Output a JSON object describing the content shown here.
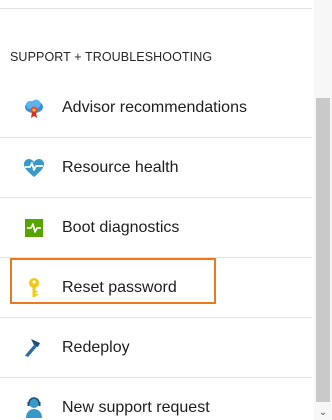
{
  "section": {
    "title": "SUPPORT + TROUBLESHOOTING"
  },
  "items": [
    {
      "label": "Advisor recommendations",
      "icon": "advisor-icon"
    },
    {
      "label": "Resource health",
      "icon": "heart-icon"
    },
    {
      "label": "Boot diagnostics",
      "icon": "diagnostics-icon"
    },
    {
      "label": "Reset password",
      "icon": "key-icon",
      "highlighted": true
    },
    {
      "label": "Redeploy",
      "icon": "hammer-icon"
    },
    {
      "label": "New support request",
      "icon": "support-person-icon"
    }
  ],
  "colors": {
    "highlight": "#ec7a1c",
    "advisor_cloud": "#3a8fd9",
    "heart": "#3999c6",
    "diagnostics": "#57a300",
    "key": "#f2c811",
    "hammer": "#1f4e79",
    "support": "#3999c6"
  },
  "scrollbar": {
    "down_arrow": "⌄"
  }
}
